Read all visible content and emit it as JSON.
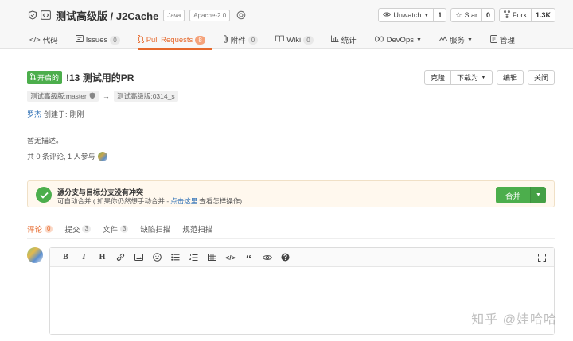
{
  "repo": {
    "name": "测试高级版 / J2Cache",
    "tags": [
      "Java",
      "Apache-2.0"
    ],
    "actions": [
      {
        "label": "Unwatch",
        "count": "1",
        "icon": "eye-icon",
        "has_caret": true
      },
      {
        "label": "Star",
        "count": "0",
        "icon": "star-icon",
        "has_caret": false
      },
      {
        "label": "Fork",
        "count": "1.3K",
        "icon": "fork-icon",
        "has_caret": false
      }
    ]
  },
  "tabs": [
    {
      "label": "代码",
      "icon": "code-icon",
      "badge": ""
    },
    {
      "label": "Issues",
      "icon": "issues-icon",
      "badge": "0"
    },
    {
      "label": "Pull Requests",
      "icon": "pull-request-icon",
      "badge": "8",
      "active": true
    },
    {
      "label": "附件",
      "icon": "attachment-icon",
      "badge": "0"
    },
    {
      "label": "Wiki",
      "icon": "wiki-icon",
      "badge": "0"
    },
    {
      "label": "统计",
      "icon": "stats-icon",
      "badge": ""
    },
    {
      "label": "DevOps",
      "icon": "devops-icon",
      "badge": "",
      "caret": true
    },
    {
      "label": "服务",
      "icon": "service-icon",
      "badge": "",
      "caret": true
    },
    {
      "label": "管理",
      "icon": "manage-icon",
      "badge": ""
    }
  ],
  "pr": {
    "state": "开启的",
    "title": "!13 测试用的PR",
    "buttons": {
      "clone": "克隆",
      "download": "下载为",
      "edit": "编辑",
      "close": "关闭"
    },
    "source_branch": "测试高级版:master",
    "target_branch": "测试高级版:0314_s",
    "arrow": "→",
    "author": "罗杰",
    "created_prefix": "创建于:",
    "created_time": "刚刚",
    "description": "暂无描述。",
    "participants_text": "共 0 条评论, 1 人参与"
  },
  "merge": {
    "title": "源分支与目标分支没有冲突",
    "sub_prefix": "可自动合并 ( 如果你仍然想手动合并 - ",
    "sub_link": "点击这里",
    "sub_suffix": " 查看怎样操作)",
    "button": "合并",
    "status_color": "#4cae4c"
  },
  "comment_tabs": [
    {
      "label": "评论",
      "badge": "0",
      "active": true
    },
    {
      "label": "提交",
      "badge": "3"
    },
    {
      "label": "文件",
      "badge": "3"
    },
    {
      "label": "缺陷扫描",
      "badge": ""
    },
    {
      "label": "规范扫描",
      "badge": ""
    }
  ],
  "toolbar": {
    "bold": "B",
    "italic": "I",
    "heading": "H",
    "quote": "“",
    "items": [
      "bold-icon",
      "italic-icon",
      "heading-icon",
      "link-icon",
      "image-icon",
      "emoji-icon",
      "unordered-list-icon",
      "ordered-list-icon",
      "table-icon",
      "code-icon",
      "quote-icon",
      "preview-icon",
      "help-icon",
      "fullscreen-icon"
    ]
  },
  "watermark": "知乎 @娃哈哈",
  "colors": {
    "accent": "#e6682b",
    "success": "#4cae4c",
    "link": "#2d6fb5"
  }
}
